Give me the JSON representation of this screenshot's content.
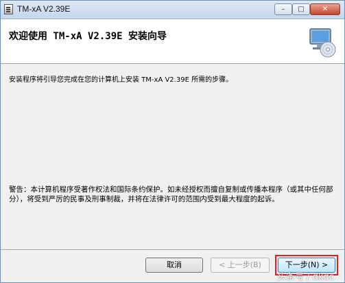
{
  "window": {
    "title": "TM-xA V2.39E",
    "controls": {
      "minimize": "–",
      "maximize": "□",
      "close": "✕"
    }
  },
  "header": {
    "heading": "欢迎使用 TM-xA V2.39E 安装向导",
    "icon": "computer-cd-icon"
  },
  "body": {
    "description": "安装程序将引导您完成在您的计算机上安装 TM-xA V2.39E 所需的步骤。",
    "warning": "警告：本计算机程序受著作权法和国际条约保护。如未经授权而擅自复制或传播本程序（或其中任何部分），将受到严厉的民事及刑事制裁，并将在法律许可的范围内受到最大程度的起诉。"
  },
  "buttons": {
    "cancel": "取消",
    "back": "< 上一步(B)",
    "next": "下一步(N) >"
  },
  "watermark": "头条号 / dkdc",
  "colors": {
    "highlight": "#e0201b",
    "title_bar": "#c3d6ec"
  }
}
